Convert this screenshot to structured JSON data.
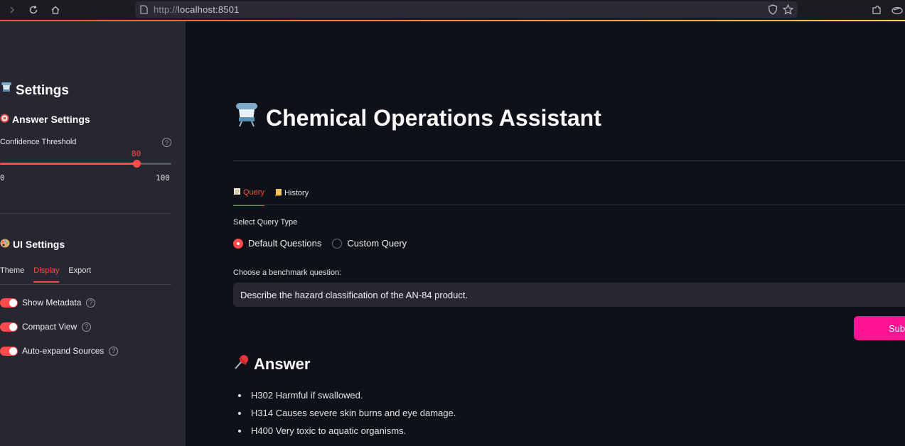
{
  "browser": {
    "url_scheme": "http://",
    "url_host": "localhost:8501"
  },
  "sidebar": {
    "title": "Settings",
    "answer_settings": {
      "heading": "Answer Settings",
      "slider_label": "Confidence Threshold",
      "slider_value": "80",
      "slider_min": "0",
      "slider_max": "100",
      "slider_fraction": 0.8
    },
    "ui_settings": {
      "heading": "UI Settings",
      "tabs": [
        "Theme",
        "Display",
        "Export"
      ],
      "active_tab": "Display",
      "toggles": [
        {
          "label": "Show Metadata",
          "on": true
        },
        {
          "label": "Compact View",
          "on": true
        },
        {
          "label": "Auto-expand Sources",
          "on": true
        }
      ]
    }
  },
  "main": {
    "title": "Chemical Operations Assistant",
    "tabs": [
      {
        "label": "Query",
        "icon": "memo-icon",
        "active": true
      },
      {
        "label": "History",
        "icon": "scroll-icon",
        "active": false
      }
    ],
    "query_type_label": "Select Query Type",
    "query_types": [
      {
        "label": "Default Questions",
        "selected": true
      },
      {
        "label": "Custom Query",
        "selected": false
      }
    ],
    "benchmark_label": "Choose a benchmark question:",
    "benchmark_value": "Describe the hazard classification of the AN-84 product.",
    "submit_label": "Sub",
    "answer_heading": "Answer",
    "answer_items": [
      "H302 Harmful if swallowed.",
      "H314 Causes severe skin burns and eye damage.",
      "H400 Very toxic to aquatic organisms."
    ]
  },
  "colors": {
    "accent": "#ff4b4b",
    "submit": "#ff1493",
    "sidebar_bg": "#262730",
    "main_bg": "#0e1117"
  }
}
